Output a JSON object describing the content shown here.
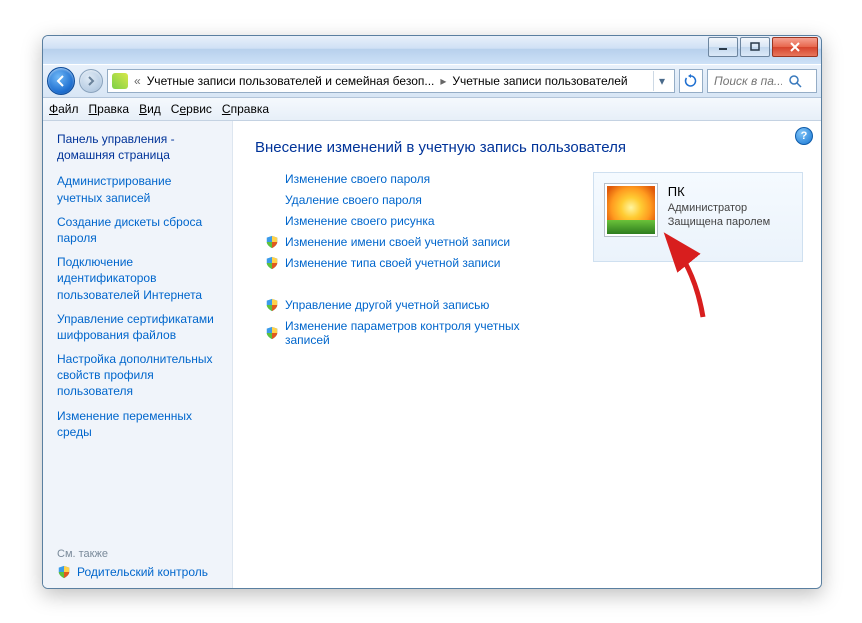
{
  "titlebar": {},
  "nav": {
    "breadcrumb_part1": "Учетные записи пользователей и семейная безоп...",
    "breadcrumb_part2": "Учетные записи пользователей",
    "search_placeholder": "Поиск в па..."
  },
  "menu": {
    "file": "Файл",
    "edit": "Правка",
    "view": "Вид",
    "tools": "Сервис",
    "help": "Справка"
  },
  "sidebar": {
    "home": "Панель управления - домашняя страница",
    "tasks": [
      "Администрирование учетных записей",
      "Создание дискеты сброса пароля",
      "Подключение идентификаторов пользователей Интернета",
      "Управление сертификатами шифрования файлов",
      "Настройка дополнительных свойств профиля пользователя",
      "Изменение переменных среды"
    ],
    "see_also_label": "См. также",
    "see_also_link": "Родительский контроль"
  },
  "main": {
    "heading": "Внесение изменений в учетную запись пользователя",
    "actions_plain": [
      "Изменение своего пароля",
      "Удаление своего пароля",
      "Изменение своего рисунка"
    ],
    "actions_shield_1": [
      "Изменение имени своей учетной записи",
      "Изменение типа своей учетной записи"
    ],
    "actions_shield_2": [
      "Управление другой учетной записью",
      "Изменение параметров контроля учетных записей"
    ],
    "account": {
      "name": "ПК",
      "role": "Администратор",
      "status": "Защищена паролем"
    }
  }
}
